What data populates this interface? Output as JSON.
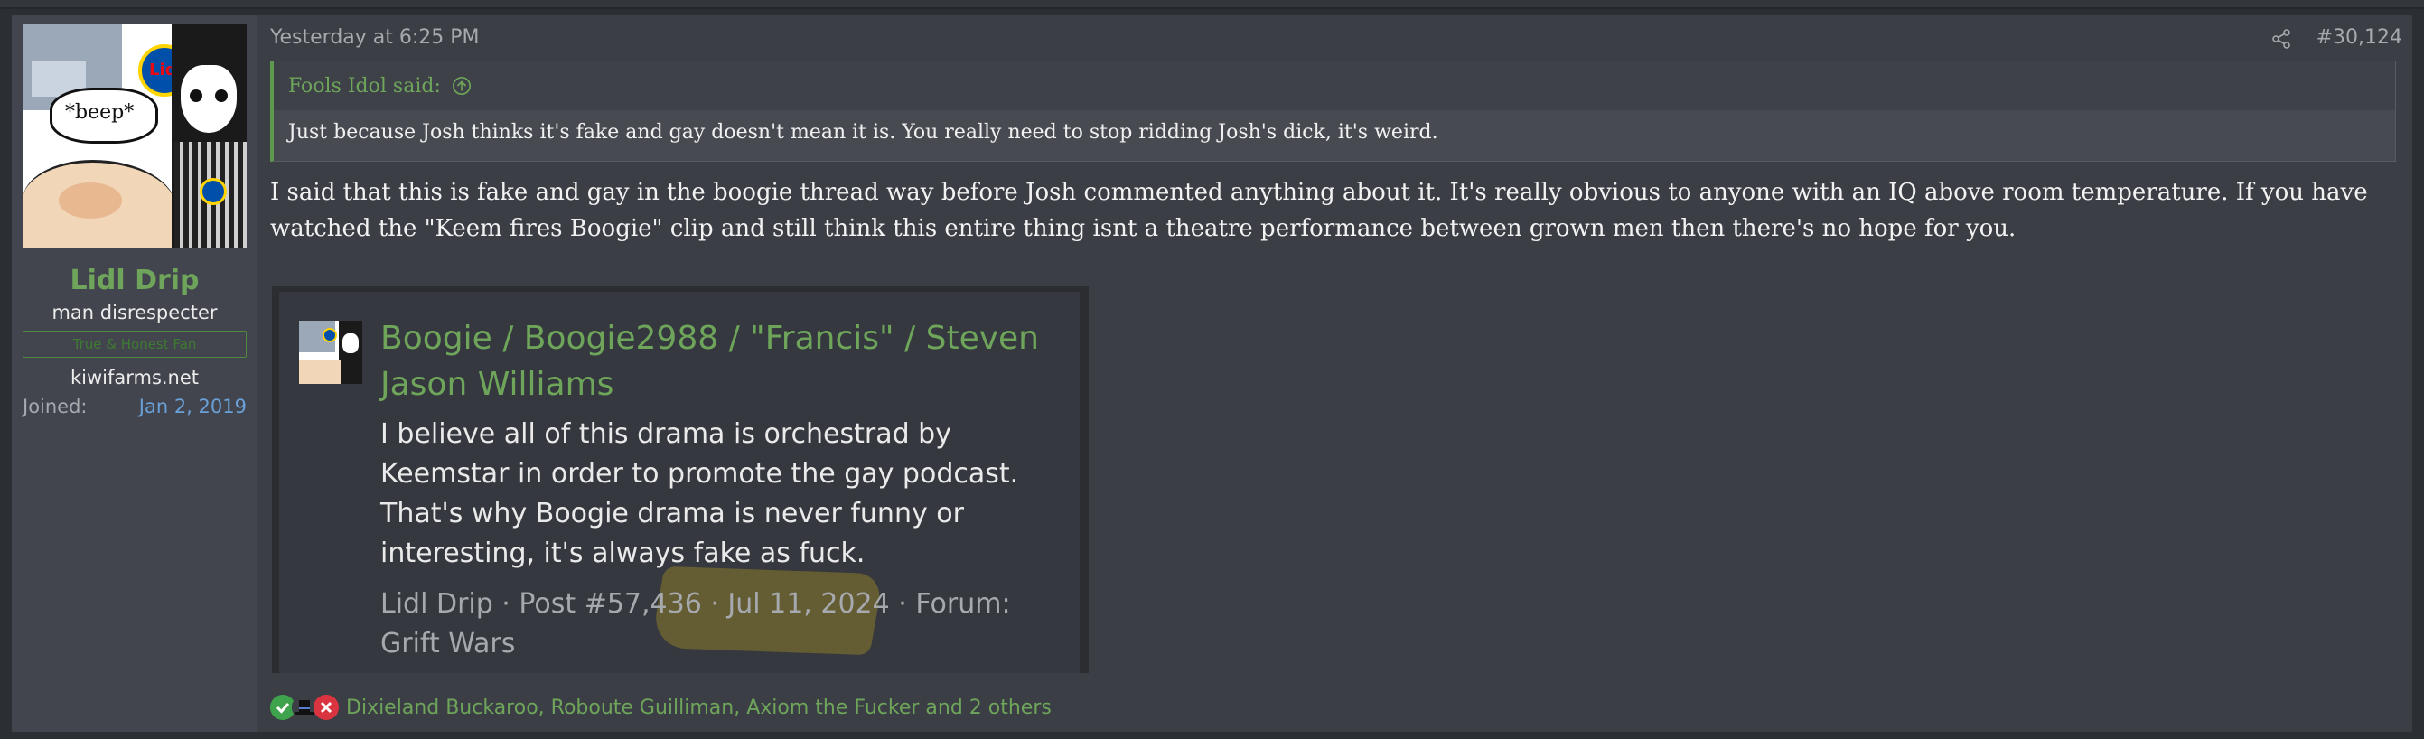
{
  "post": {
    "date": "Yesterday at 6:25 PM",
    "number": "#30,124",
    "share_icon": "share-icon"
  },
  "user": {
    "avatar_text": "*beep*",
    "avatar_logo_text": "Lidl",
    "name": "Lidl Drip",
    "title": "man disrespecter",
    "banner": "True & Honest Fan",
    "site": "kiwifarms.net",
    "joined_label": "Joined:",
    "joined_value": "Jan 2, 2019"
  },
  "quote": {
    "author": "Fools Idol said:",
    "body": "Just because Josh thinks it's fake and gay doesn't mean it is. You really need to stop ridding Josh's dick, it's weird."
  },
  "message": "I said that this is fake and gay in the boogie thread way before Josh commented anything about it. It's really obvious to anyone with an IQ above room temperature. If you have watched the \"Keem fires Boogie\" clip and still think this entire thing isnt a theatre performance between grown men then there's no hope for you.",
  "embed": {
    "title": "Boogie / Boogie2988 / \"Francis\" / Steven Jason Williams",
    "text": "I believe all of this drama is orchestrad by Keemstar in order to promote the gay podcast. That's why Boogie drama is never funny or interesting, it's always fake as fuck.",
    "meta": "Lidl Drip · Post #57,436 · Jul 11, 2024 · Forum: Grift Wars"
  },
  "reactions": {
    "icons": [
      "check-icon",
      "top-hat-icon",
      "x-icon"
    ],
    "text": "Dixieland Buckaroo, Roboute Guilliman, Axiom the Fucker and 2 others"
  },
  "colors": {
    "accent_green": "#6ea55a",
    "link_blue": "#6aa0d8",
    "background": "#3b3e45"
  }
}
